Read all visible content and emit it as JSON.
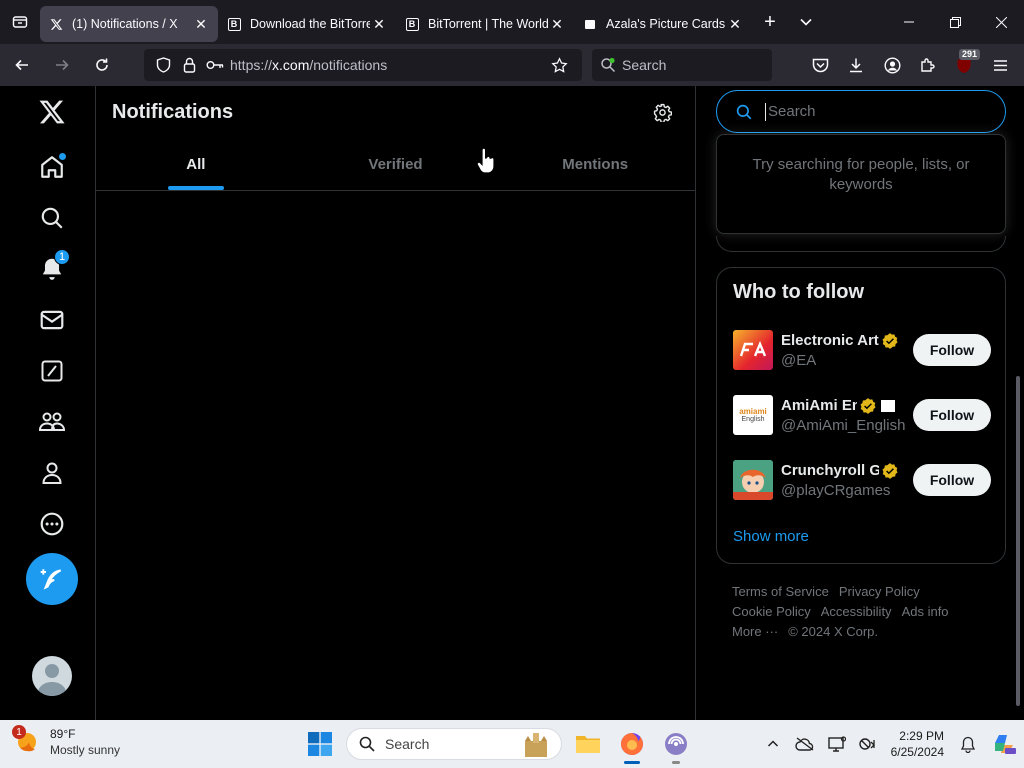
{
  "browser": {
    "tabs": [
      {
        "title": "(1) Notifications / X",
        "favicon": "x-logo-icon",
        "active": true
      },
      {
        "title": "Download the BitTorrent",
        "favicon": "bittorrent-b-icon",
        "active": false
      },
      {
        "title": "BitTorrent | The World's",
        "favicon": "bittorrent-b-icon",
        "active": false
      },
      {
        "title": "Azala's Picture Cards O",
        "favicon": "picture-icon",
        "active": false
      }
    ],
    "url_prefix": "https://",
    "url_domain": "x.com",
    "url_path": "/notifications",
    "search_placeholder": "Search",
    "extension_badge": "291"
  },
  "x": {
    "header_title": "Notifications",
    "tabs": [
      "All",
      "Verified",
      "Mentions"
    ],
    "notif_badge": "1",
    "search": {
      "placeholder": "Search",
      "dropdown_hint": "Try searching for people, lists, or keywords"
    },
    "who_to_follow": {
      "title": "Who to follow",
      "accounts": [
        {
          "name": "Electronic Arts",
          "handle": "@EA",
          "button": "Follow"
        },
        {
          "name": "AmiAmi English",
          "handle": "@AmiAmi_English",
          "button": "Follow",
          "avatar_text_1": "amiami",
          "avatar_text_2": "English"
        },
        {
          "name": "Crunchyroll Games",
          "handle": "@playCRgames",
          "button": "Follow"
        }
      ],
      "show_more": "Show more"
    },
    "footer": [
      "Terms of Service",
      "Privacy Policy",
      "Cookie Policy",
      "Accessibility",
      "Ads info",
      "More ···",
      "© 2024 X Corp."
    ],
    "colors": {
      "accent": "#1d9bf0",
      "background": "#000000",
      "border": "#2f3336",
      "muted_text": "#71767b"
    }
  },
  "taskbar": {
    "weather_temp": "89°F",
    "weather_desc": "Mostly sunny",
    "weather_badge": "1",
    "search_label": "Search",
    "time": "2:29 PM",
    "date": "6/25/2024"
  }
}
